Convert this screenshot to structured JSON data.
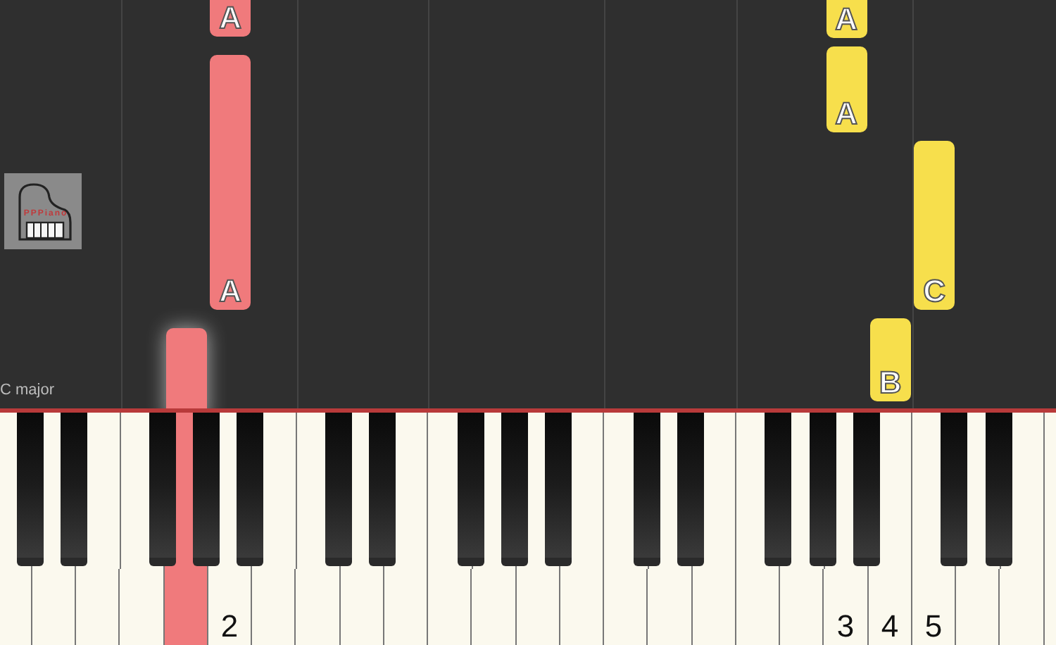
{
  "logo": {
    "text": "PPPiano"
  },
  "scale_label": "C major",
  "notes": [
    {
      "label": "A",
      "color": "#f07a7c"
    },
    {
      "label": "A",
      "color": "#f07a7c"
    },
    {
      "color": "#f07a7c"
    },
    {
      "label": "A",
      "color": "#f7df4c"
    },
    {
      "label": "A",
      "color": "#f7df4c"
    },
    {
      "label": "C",
      "color": "#f7df4c"
    },
    {
      "label": "B",
      "color": "#f7df4c"
    }
  ],
  "keyboard": {
    "keys": [
      {
        "pressed": false
      },
      {
        "pressed": false
      },
      {
        "pressed": false
      },
      {
        "pressed": false
      },
      {
        "pressed": true
      },
      {
        "pressed": false,
        "finger": "2"
      },
      {
        "pressed": false
      },
      {
        "pressed": false
      },
      {
        "pressed": false
      },
      {
        "pressed": false
      },
      {
        "pressed": false
      },
      {
        "pressed": false
      },
      {
        "pressed": false
      },
      {
        "pressed": false
      },
      {
        "pressed": false
      },
      {
        "pressed": false
      },
      {
        "pressed": false
      },
      {
        "pressed": false
      },
      {
        "pressed": false
      },
      {
        "pressed": false,
        "finger": "3"
      },
      {
        "pressed": false,
        "finger": "4"
      },
      {
        "pressed": false,
        "finger": "5"
      },
      {
        "pressed": false
      },
      {
        "pressed": false
      }
    ]
  }
}
